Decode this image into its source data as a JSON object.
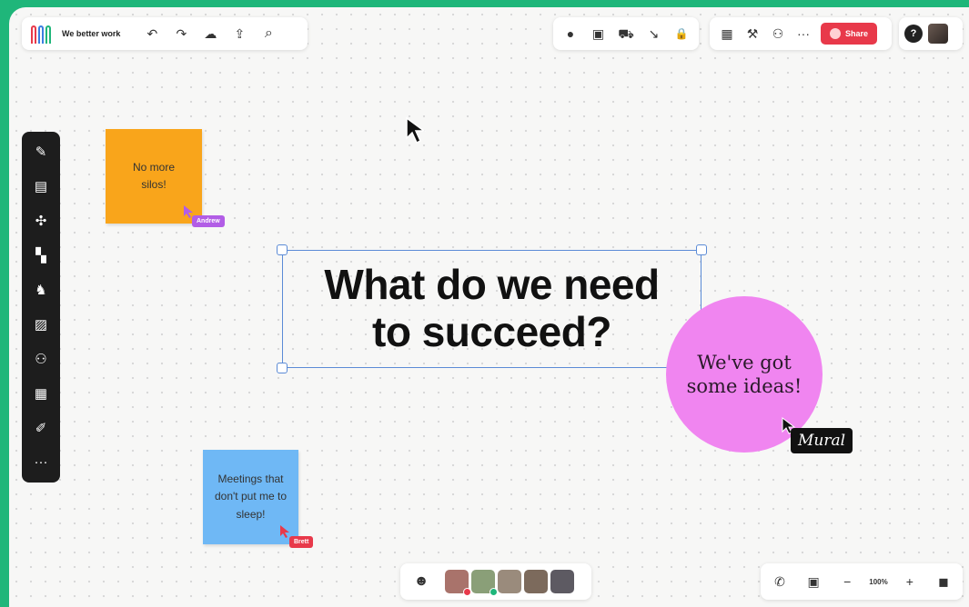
{
  "colors": {
    "accent_green": "#1fb67a",
    "share_red": "#e8394a",
    "sticky_orange": "#f9a51b",
    "sticky_blue": "#6fb8f5",
    "circle_pink": "#f085f0",
    "selection_blue": "#5b8bd6"
  },
  "toolbar": {
    "board_title": "We better work",
    "undo_icon": "↶",
    "redo_icon": "↷",
    "cloud_icon": "☁",
    "share_out_icon": "⇪",
    "search_icon": "⌕"
  },
  "toolbar_mid": {
    "icons": [
      "●",
      "▣",
      "⛟",
      "↘",
      "🔒"
    ]
  },
  "toolbar_share": {
    "icons": [
      "▦",
      "⚒",
      "⚇"
    ],
    "more": "···",
    "share_label": "Share"
  },
  "toolbar_user": {
    "help_icon": "?"
  },
  "sidebar": {
    "items": [
      {
        "name": "sticky-note-tool",
        "icon": "✎"
      },
      {
        "name": "text-tool",
        "icon": "▤"
      },
      {
        "name": "shapes-tool",
        "icon": "✣"
      },
      {
        "name": "templates-tool",
        "icon": "▚"
      },
      {
        "name": "icons-tool",
        "icon": "♞"
      },
      {
        "name": "images-tool",
        "icon": "▨"
      },
      {
        "name": "diagram-tool",
        "icon": "⚇"
      },
      {
        "name": "table-tool",
        "icon": "▦"
      },
      {
        "name": "pen-tool",
        "icon": "✐"
      },
      {
        "name": "more-tools",
        "icon": "···"
      }
    ]
  },
  "canvas": {
    "sticky_orange_text": "No more silos!",
    "sticky_orange_author": "Andrew",
    "sticky_blue_text": "Meetings that don't put me to sleep!",
    "sticky_blue_author": "Brett",
    "headline_line1": "What do we need",
    "headline_line2": "to succeed?",
    "circle_line1": "We've got",
    "circle_line2": "some ideas!",
    "mural_label": "Mural"
  },
  "bottom_bar": {
    "people_icon": "☻",
    "collaborators": [
      {
        "name": "collaborator-1",
        "color": "#a9736b",
        "status": "#e8394a"
      },
      {
        "name": "collaborator-2",
        "color": "#8a9f78",
        "status": "#1fb67a"
      },
      {
        "name": "collaborator-3",
        "color": "#9a8b7c",
        "status": ""
      },
      {
        "name": "collaborator-4",
        "color": "#7c6a5c",
        "status": ""
      },
      {
        "name": "collaborator-5",
        "color": "#5d5a62",
        "status": ""
      }
    ]
  },
  "zoom_bar": {
    "phone_icon": "✆",
    "chat_icon": "▣",
    "zoom_out": "−",
    "zoom_level": "100%",
    "zoom_in": "+",
    "fit_icon": "◼"
  }
}
